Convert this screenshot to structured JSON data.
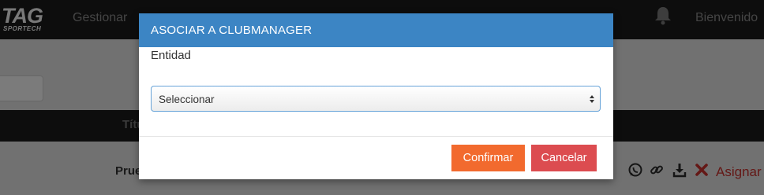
{
  "header": {
    "logo_main": "TAG",
    "logo_sub": "SPORTECH",
    "nav_item": "Gestionar",
    "welcome": "Bienvenido"
  },
  "table": {
    "column_title": "Títu",
    "row_name": "Prue",
    "assign_label": "Asignar"
  },
  "modal": {
    "title": "ASOCIAR A CLUBMANAGER",
    "field_label": "Entidad",
    "select_value": "Seleccionar",
    "confirm_label": "Confirmar",
    "cancel_label": "Cancelar"
  },
  "colors": {
    "modal_header": "#3c85c4",
    "confirm_button": "#f26a2e",
    "cancel_button": "#dc4c50",
    "assign_link": "#c9302c"
  },
  "icons": [
    "bell-icon",
    "whatsapp-icon",
    "link-icon",
    "download-icon",
    "delete-icon",
    "select-arrows-icon"
  ]
}
